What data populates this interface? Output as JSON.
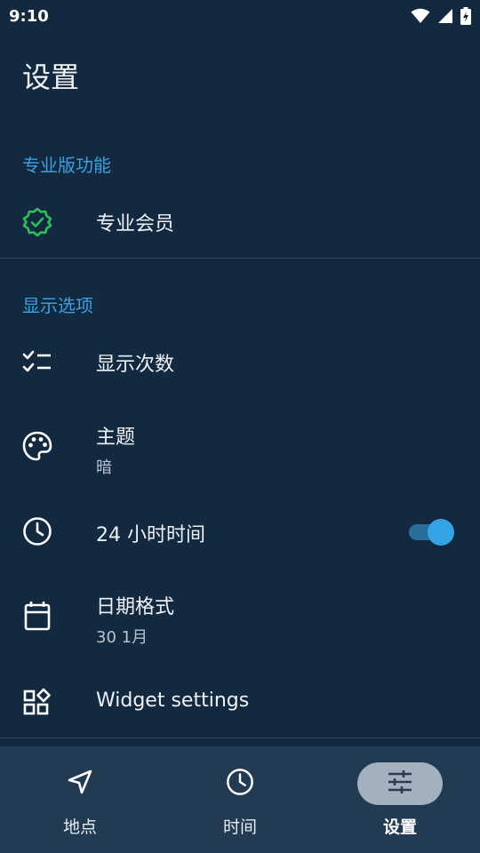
{
  "status_bar": {
    "time": "9:10",
    "icons": [
      "wifi-icon",
      "cell-signal-icon",
      "battery-charging-icon"
    ]
  },
  "page": {
    "title": "设置"
  },
  "sections": {
    "pro": {
      "header": "专业版功能"
    },
    "display": {
      "header": "显示选项"
    }
  },
  "items": {
    "pro_member": {
      "title": "专业会员",
      "icon": "verified-badge-icon"
    },
    "show_count": {
      "title": "显示次数",
      "icon": "checklist-icon"
    },
    "theme": {
      "title": "主题",
      "subtitle": "暗",
      "icon": "palette-icon"
    },
    "time24": {
      "title": "24 小时时间",
      "icon": "clock-icon",
      "enabled": true
    },
    "date_format": {
      "title": "日期格式",
      "subtitle": "30 1月",
      "icon": "calendar-icon"
    },
    "widget": {
      "title": "Widget settings",
      "icon": "widgets-icon"
    }
  },
  "bottom_nav": {
    "items": [
      {
        "label": "地点",
        "icon": "navigation-arrow-icon",
        "active": false
      },
      {
        "label": "时间",
        "icon": "clock-icon",
        "active": false
      },
      {
        "label": "设置",
        "icon": "sliders-icon",
        "active": true
      }
    ]
  },
  "colors": {
    "background": "#13293f",
    "accent": "#3aa0e2",
    "verified_green": "#2fbf5a",
    "nav_background": "#223a52",
    "nav_active_pill": "#a3b1bf"
  }
}
